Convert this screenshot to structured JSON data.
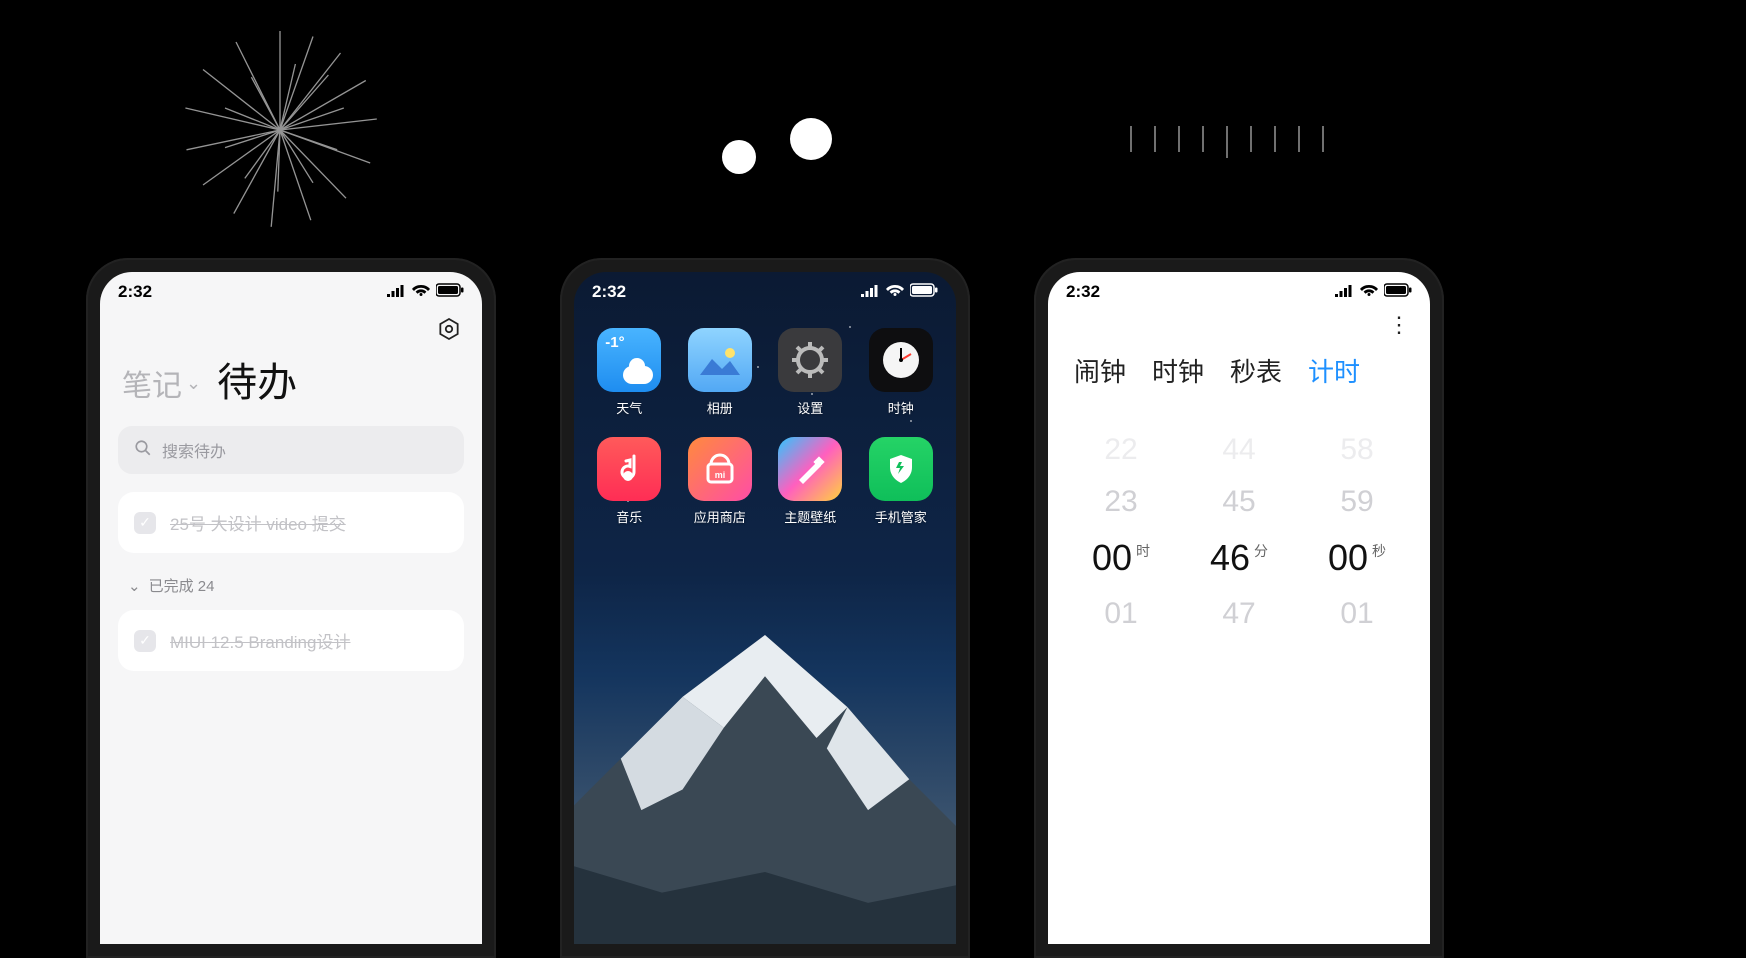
{
  "status": {
    "time": "2:32"
  },
  "firework": {
    "name": "firework-icon"
  },
  "ticks": {
    "count": 9
  },
  "notes": {
    "tab_notes": "笔记",
    "tab_todo": "待办",
    "search_placeholder": "搜索待办",
    "todo1": "25号 大设计 video 提交",
    "done_label": "已完成 24",
    "todo2": "MIUI 12.5 Branding设计"
  },
  "home": {
    "weather_temp": "-1°",
    "apps": [
      {
        "label": "天气"
      },
      {
        "label": "相册"
      },
      {
        "label": "设置"
      },
      {
        "label": "时钟"
      },
      {
        "label": "音乐"
      },
      {
        "label": "应用商店"
      },
      {
        "label": "主题壁纸"
      },
      {
        "label": "手机管家"
      }
    ]
  },
  "clock": {
    "tabs": {
      "alarm": "闹钟",
      "clock": "时钟",
      "stopwatch": "秒表",
      "timer": "计时"
    },
    "hours": {
      "prev2": "22",
      "prev1": "23",
      "sel": "00",
      "unit": "时",
      "next1": "01"
    },
    "minutes": {
      "prev2": "44",
      "prev1": "45",
      "sel": "46",
      "unit": "分",
      "next1": "47"
    },
    "seconds": {
      "prev2": "58",
      "prev1": "59",
      "sel": "00",
      "unit": "秒",
      "next1": "01"
    }
  }
}
